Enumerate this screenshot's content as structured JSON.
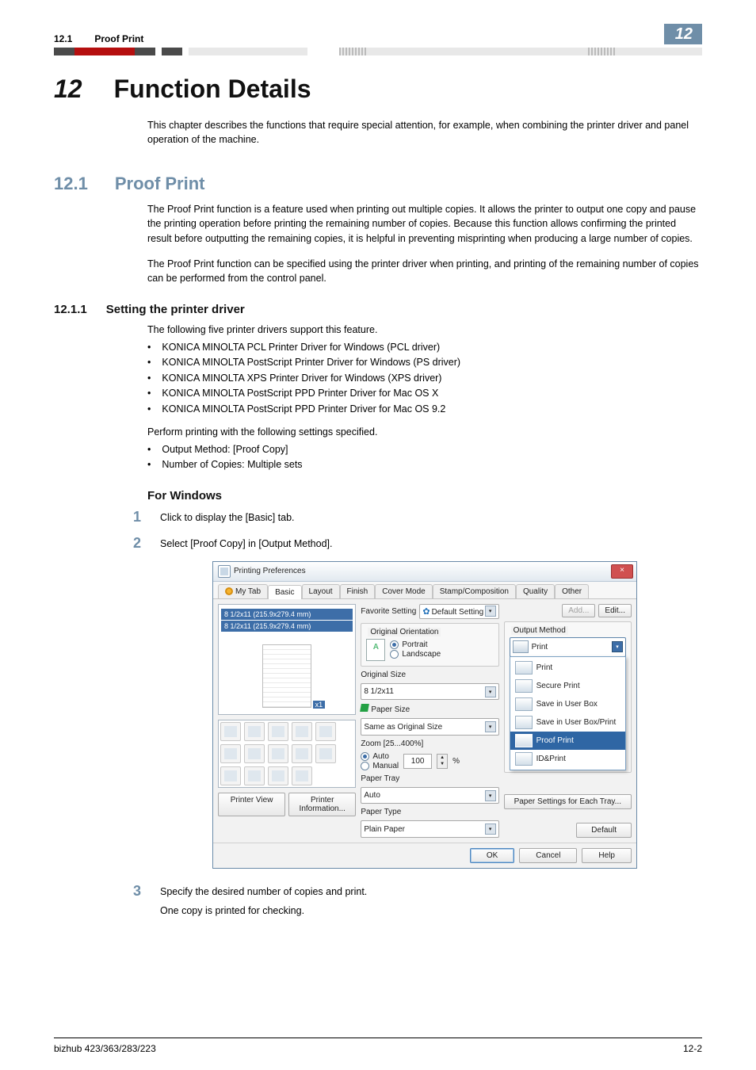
{
  "header": {
    "section_num": "12.1",
    "section_title": "Proof Print",
    "chapter_badge": "12"
  },
  "h1": {
    "num": "12",
    "title": "Function Details"
  },
  "intro": "This chapter describes the functions that require special attention, for example, when combining the printer driver and panel operation of the machine.",
  "h2": {
    "num": "12.1",
    "title": "Proof Print"
  },
  "h2_body1": "The Proof Print function is a feature used when printing out multiple copies. It allows the printer to output one copy and pause the printing operation before printing the remaining number of copies. Because this function allows confirming the printed result before outputting the remaining copies, it is helpful in preventing misprinting when producing a large number of copies.",
  "h2_body2": "The Proof Print function can be specified using the printer driver when printing, and printing of the remaining number of copies can be performed from the control panel.",
  "h3": {
    "num": "12.1.1",
    "title": "Setting the printer driver"
  },
  "h3_lead": "The following five printer drivers support this feature.",
  "drivers": [
    "KONICA MINOLTA PCL Printer Driver for Windows (PCL driver)",
    "KONICA MINOLTA PostScript Printer Driver for Windows (PS driver)",
    "KONICA MINOLTA XPS Printer Driver for Windows (XPS driver)",
    "KONICA MINOLTA PostScript PPD Printer Driver for Mac OS X",
    "KONICA MINOLTA PostScript PPD Printer Driver for Mac OS 9.2"
  ],
  "h3_lead2": "Perform printing with the following settings specified.",
  "settings": [
    "Output Method: [Proof Copy]",
    "Number of Copies: Multiple sets"
  ],
  "h4": "For Windows",
  "steps": {
    "s1": {
      "num": "1",
      "text": "Click to display the [Basic] tab."
    },
    "s2": {
      "num": "2",
      "text": "Select [Proof Copy] in [Output Method]."
    },
    "s3": {
      "num": "3",
      "text1": "Specify the desired number of copies and print.",
      "text2": "One copy is printed for checking."
    }
  },
  "dialog": {
    "title": "Printing Preferences",
    "close": "×",
    "tabs": [
      "My Tab",
      "Basic",
      "Layout",
      "Finish",
      "Cover Mode",
      "Stamp/Composition",
      "Quality",
      "Other"
    ],
    "active_tab_index": 1,
    "preview": {
      "bar1": "8 1/2x11 (215.9x279.4 mm)",
      "bar2": "8 1/2x11 (215.9x279.4 mm)",
      "multiplier": "x1"
    },
    "left_buttons": {
      "printer_view": "Printer View",
      "printer_info": "Printer Information..."
    },
    "favorite": {
      "label": "Favorite Setting",
      "value": "Default Setting",
      "add": "Add...",
      "edit": "Edit..."
    },
    "orientation": {
      "title": "Original Orientation",
      "portrait": "Portrait",
      "landscape": "Landscape"
    },
    "original_size": {
      "label": "Original Size",
      "value": "8 1/2x11"
    },
    "paper_size": {
      "label": "Paper Size",
      "value": "Same as Original Size"
    },
    "zoom": {
      "label": "Zoom [25...400%]",
      "auto": "Auto",
      "manual": "Manual",
      "value": "100",
      "pct": "%"
    },
    "paper_tray": {
      "label": "Paper Tray",
      "value": "Auto"
    },
    "paper_type": {
      "label": "Paper Type",
      "value": "Plain Paper"
    },
    "output_method": {
      "title": "Output Method",
      "selected": "Print"
    },
    "menu_items": [
      "Print",
      "Secure Print",
      "Save in User Box",
      "Save in User Box/Print",
      "Proof Print",
      "ID&Print"
    ],
    "menu_selected_index": 4,
    "each_tray_btn": "Paper Settings for Each Tray...",
    "default_btn": "Default",
    "bottom": {
      "ok": "OK",
      "cancel": "Cancel",
      "help": "Help"
    }
  },
  "footer": {
    "left": "bizhub 423/363/283/223",
    "right": "12-2"
  }
}
